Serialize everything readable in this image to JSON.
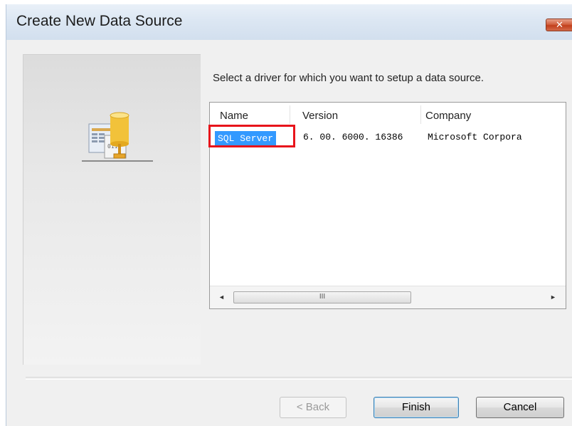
{
  "window": {
    "title": "Create New Data Source",
    "close_label": "✕"
  },
  "wizard": {
    "instruction": "Select a driver for which you want to setup a data source."
  },
  "driver_list": {
    "columns": [
      "Name",
      "Version",
      "Company"
    ],
    "rows": [
      {
        "name": "SQL Server",
        "version": "6. 00. 6000. 16386",
        "company": "Microsoft Corpora"
      }
    ],
    "selected_row": 0,
    "scroll_left": "◄",
    "scroll_right": "►",
    "scroll_grip": "III"
  },
  "buttons": {
    "back": "< Back",
    "finish": "Finish",
    "cancel": "Cancel"
  },
  "colors": {
    "selection": "#3399ff",
    "highlight_box": "#e8141b"
  },
  "icons": {
    "wizard_art": "data-source-database-icon",
    "close": "close-icon"
  }
}
